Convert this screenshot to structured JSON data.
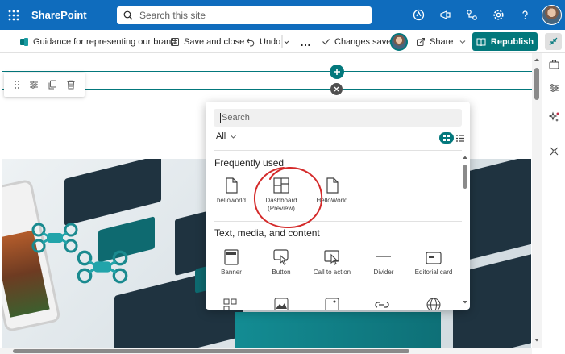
{
  "suite": {
    "brand": "SharePoint",
    "search_placeholder": "Search this site"
  },
  "command_bar": {
    "page_name": "Guidance for representing our brand",
    "save_close": "Save and close",
    "undo": "Undo",
    "more": "…",
    "status": "Changes saved",
    "share": "Share",
    "republish": "Republish"
  },
  "picker": {
    "search_placeholder": "Search",
    "filter": "All",
    "sections": [
      {
        "heading": "Frequently used",
        "items": [
          {
            "label": "helloworld",
            "icon": "document-icon"
          },
          {
            "label": "Dashboard (Preview)",
            "icon": "dashboard-icon"
          },
          {
            "label": "HelloWorld",
            "icon": "document-icon"
          }
        ]
      },
      {
        "heading": "Text, media, and content",
        "items": [
          {
            "label": "Banner",
            "icon": "banner-icon"
          },
          {
            "label": "Button",
            "icon": "button-icon"
          },
          {
            "label": "Call to action",
            "icon": "call-to-action-icon"
          },
          {
            "label": "Divider",
            "icon": "divider-icon"
          },
          {
            "label": "Editorial card",
            "icon": "editorial-card-icon"
          }
        ]
      }
    ]
  },
  "colors": {
    "suite_blue": "#0f6cbd",
    "accent_teal": "#03787c",
    "annotation_red": "#d42a2a"
  }
}
